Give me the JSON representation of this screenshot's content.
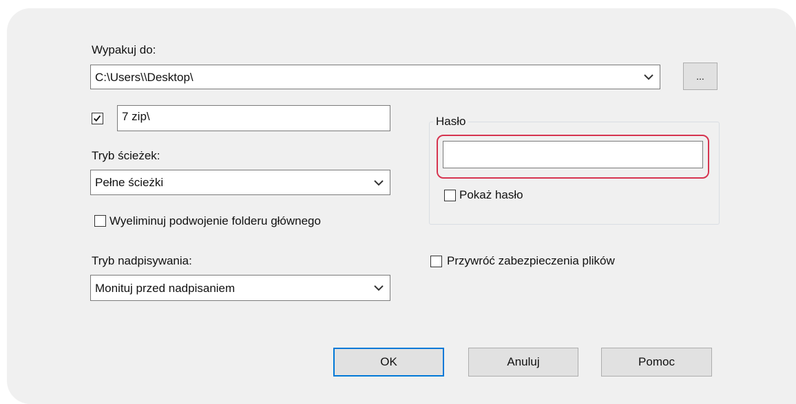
{
  "extract_to": {
    "label": "Wypakuj do:",
    "path": "C:\\Users\\\\Desktop\\",
    "browse_label": "..."
  },
  "subfolder": {
    "checked": true,
    "value": "7 zip\\"
  },
  "path_mode": {
    "label": "Tryb ścieżek:",
    "selected": "Pełne ścieżki"
  },
  "eliminate_duplicate": {
    "checked": false,
    "label": "Wyeliminuj podwojenie folderu głównego"
  },
  "overwrite_mode": {
    "label": "Tryb nadpisywania:",
    "selected": "Monituj przed nadpisaniem"
  },
  "password_group": {
    "title": "Hasło",
    "value": "",
    "show_password_label": "Pokaż hasło",
    "show_password_checked": false
  },
  "restore_security": {
    "checked": false,
    "label": "Przywróć zabezpieczenia plików"
  },
  "buttons": {
    "ok": "OK",
    "cancel": "Anuluj",
    "help": "Pomoc"
  },
  "colors": {
    "highlight": "#d6334f",
    "default_button_border": "#0078d7"
  }
}
